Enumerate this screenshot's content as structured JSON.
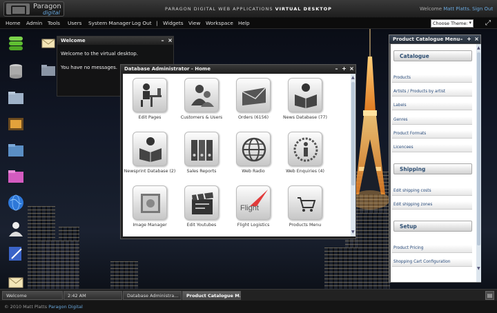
{
  "header": {
    "logo_name": "Paragon",
    "logo_sub": "digital",
    "title_prefix": "PARAGON DIGITAL WEB APPLICATIONS",
    "title_suffix": "VIRTUAL DESKTOP",
    "welcome_text": "Welcome",
    "user_name": "Matt Platts.",
    "signout_label": "Sign Out"
  },
  "menu": {
    "items": [
      "Home",
      "Admin",
      "Tools",
      "Users",
      "System Manager",
      "Log Out",
      "|",
      "Widgets",
      "View",
      "Workspace",
      "Help"
    ],
    "theme_select": "Choose Theme:"
  },
  "desktop_icons": [
    "database-green-icon",
    "database-grey-icon",
    "folder-icon",
    "picture-frame-icon",
    "folder-blue-icon",
    "pink-folder-icon",
    "globe-icon",
    "user-icon",
    "edit-doc-icon",
    "mail-icon"
  ],
  "welcome_window": {
    "title": "Welcome",
    "line1": "Welcome to the virtual desktop.",
    "line2": "You have no messages."
  },
  "dba_window": {
    "title": "Database Administrator - Home",
    "tiles": [
      {
        "label": "Edit Pages",
        "icon": "person-at-desk-icon"
      },
      {
        "label": "Customers & Users",
        "icon": "users-icon"
      },
      {
        "label": "Orders (6156)",
        "icon": "envelope-icon"
      },
      {
        "label": "News Database  (77)",
        "icon": "reading-person-icon"
      },
      {
        "label": "Newsprint Database (2)",
        "icon": "newsprint-icon"
      },
      {
        "label": "Sales Reports",
        "icon": "binders-icon"
      },
      {
        "label": "Web Radio",
        "icon": "globe-icon"
      },
      {
        "label": "Web Enquiries (4)",
        "icon": "info-icon"
      },
      {
        "label": "Image Manager",
        "icon": "image-icon"
      },
      {
        "label": "Edit Youtubes",
        "icon": "clapperboard-icon"
      },
      {
        "label": "Flight Logistics",
        "icon": "flight-logo-icon",
        "logo_text": "Flight"
      },
      {
        "label": "Products Menu",
        "icon": "shopping-cart-icon"
      }
    ]
  },
  "catalogue_window": {
    "title": "Product Catalogue Menu",
    "sections": [
      {
        "heading": "Catalogue",
        "links": [
          "Products",
          "Artists / Products by artist",
          "Labels",
          "Genres",
          "Product Formats",
          "Licencees"
        ]
      },
      {
        "heading": "Shipping",
        "links": [
          "Edit shipping costs",
          "Edit shipping zones"
        ]
      },
      {
        "heading": "Setup",
        "links": [
          "Product Pricing",
          "Shopping Cart Configuration"
        ]
      }
    ]
  },
  "taskbar": {
    "tasks": [
      "Welcome",
      "2:42 AM",
      "Database Administra...",
      "Product Catalogue M..."
    ]
  },
  "footer": {
    "copyright": "© 2010 Matt Platts",
    "brand": "Paragon Digital"
  }
}
